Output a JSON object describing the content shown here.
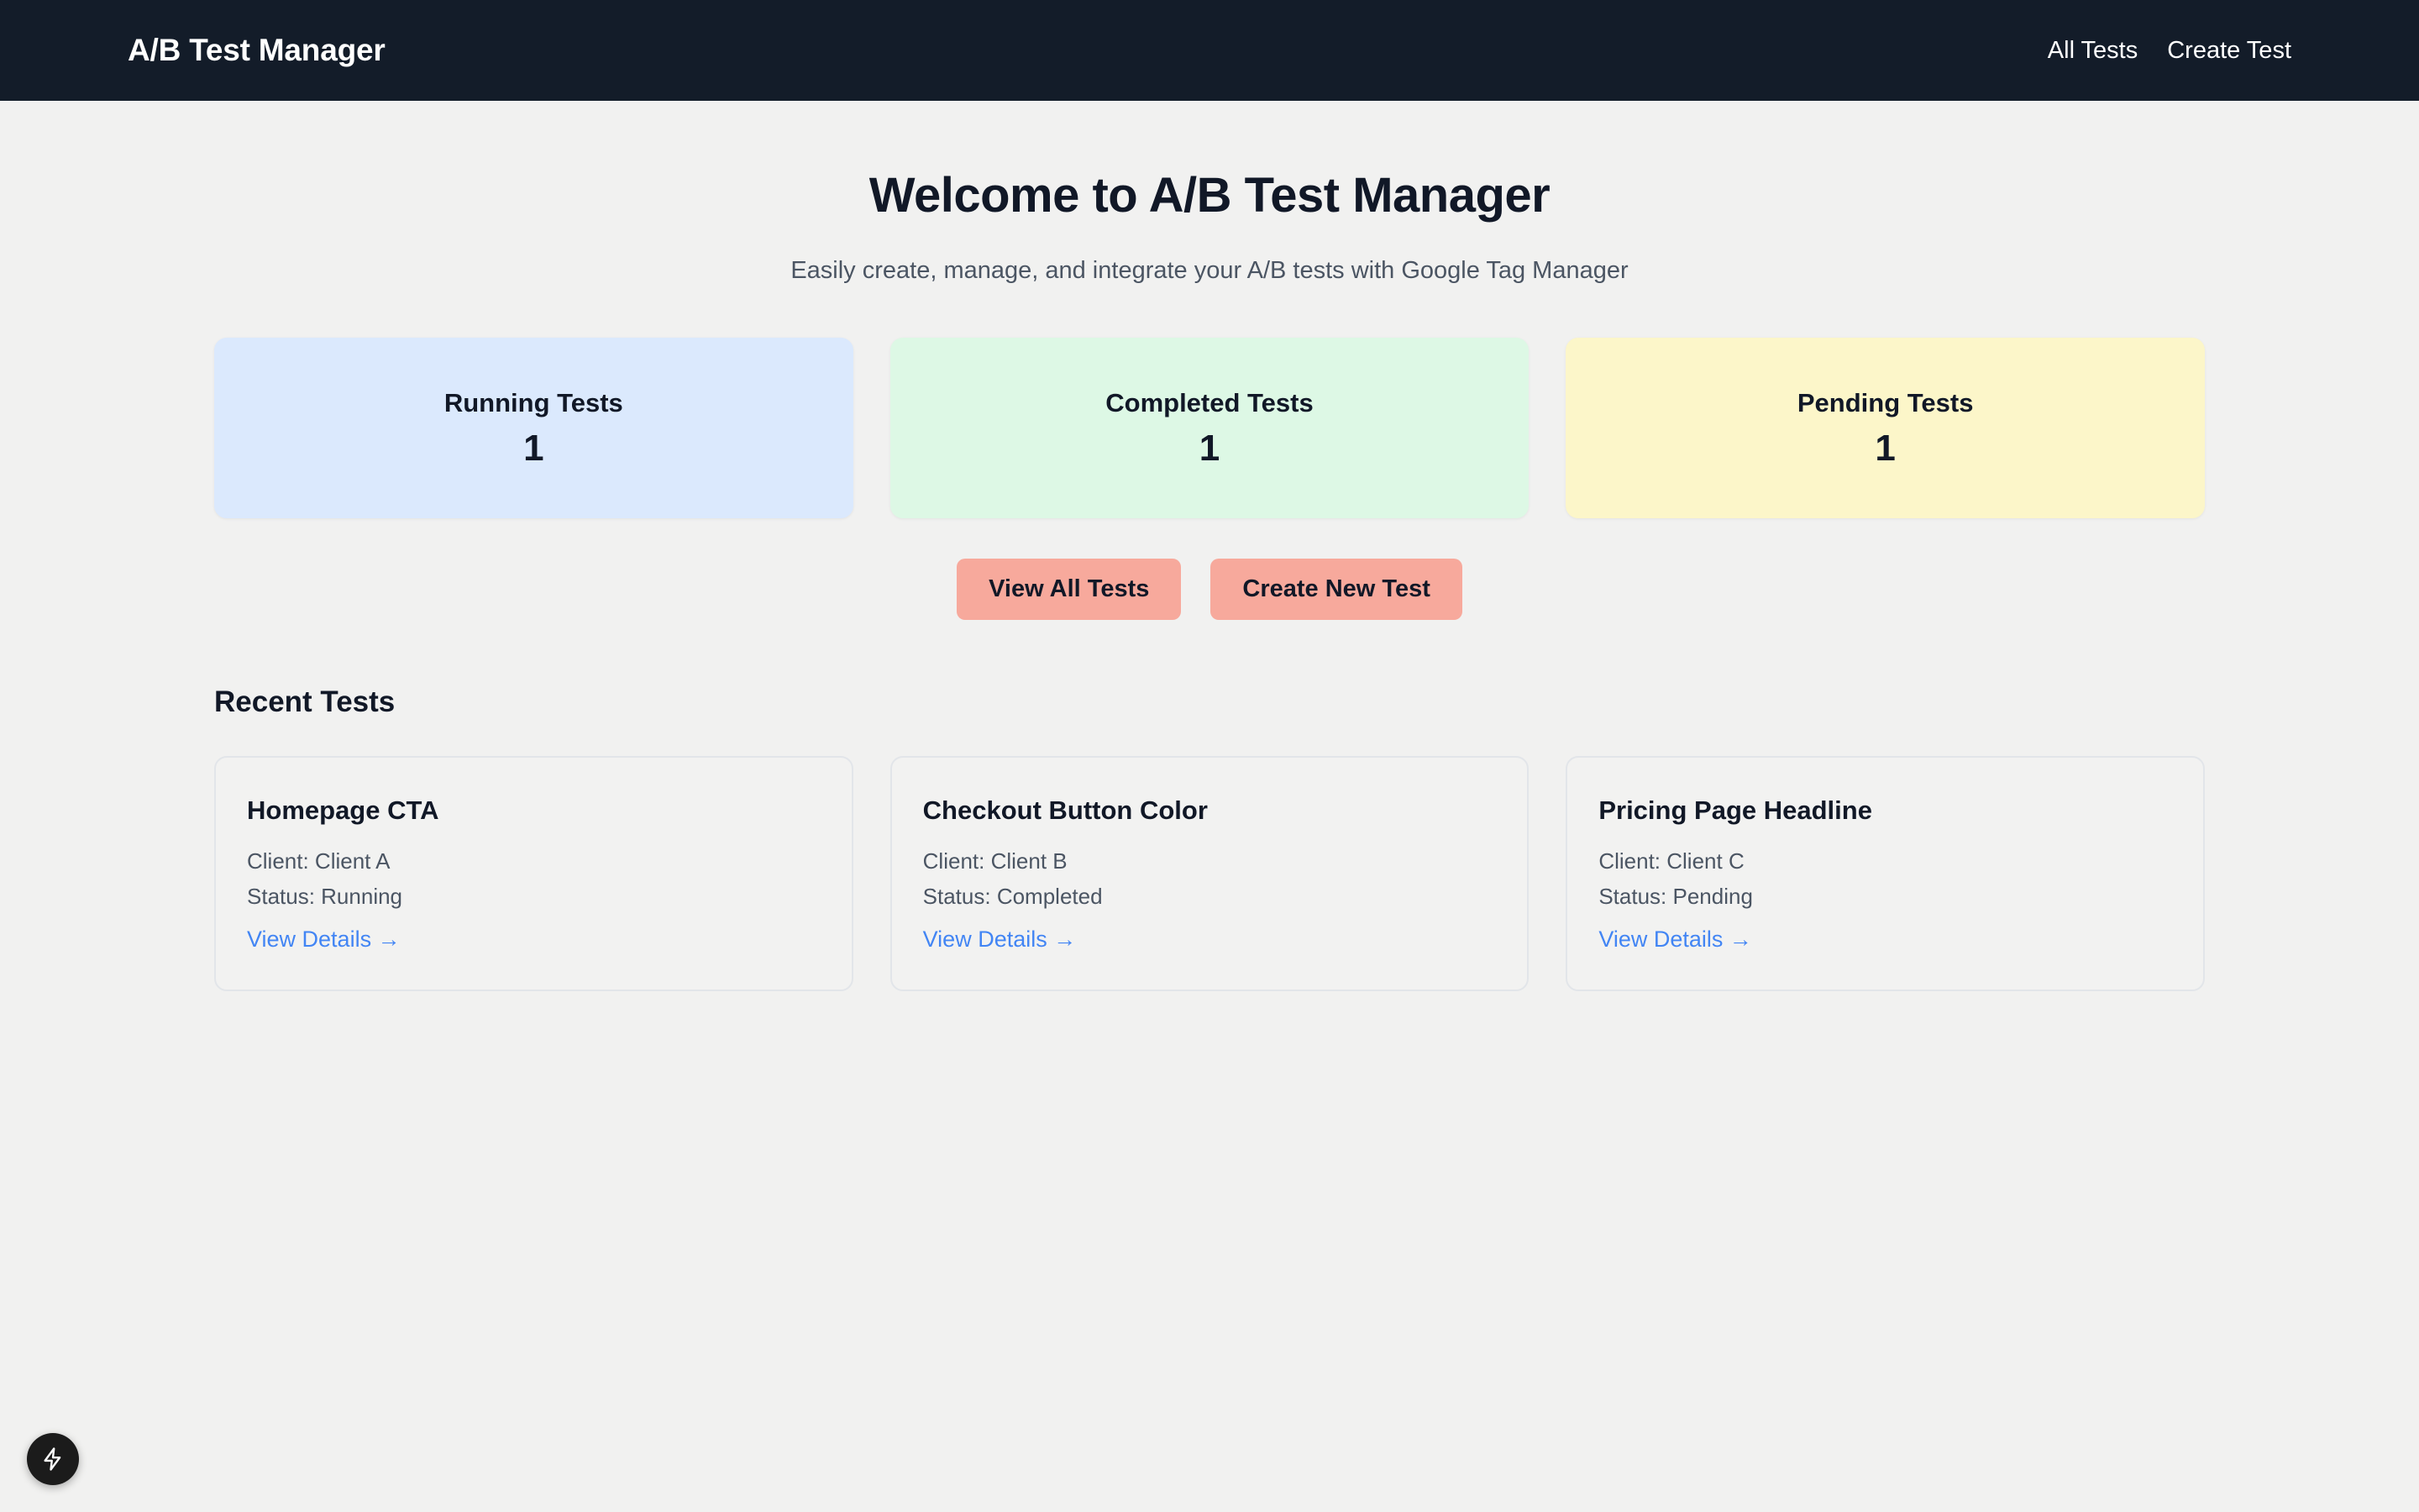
{
  "header": {
    "brand": "A/B Test Manager",
    "nav": [
      {
        "label": "All Tests"
      },
      {
        "label": "Create Test"
      }
    ]
  },
  "hero": {
    "title": "Welcome to A/B Test Manager",
    "subtitle": "Easily create, manage, and integrate your A/B tests with Google Tag Manager"
  },
  "stats": [
    {
      "label": "Running Tests",
      "value": "1",
      "color": "#dbe9fd"
    },
    {
      "label": "Completed Tests",
      "value": "1",
      "color": "#ddf8e5"
    },
    {
      "label": "Pending Tests",
      "value": "1",
      "color": "#fcf6c9"
    }
  ],
  "actions": {
    "accent_color": "#f7a99c",
    "buttons": [
      {
        "label": "View All Tests"
      },
      {
        "label": "Create New Test"
      }
    ]
  },
  "recent": {
    "section_title": "Recent Tests",
    "link_color": "#4285f4",
    "tests": [
      {
        "name": "Homepage CTA",
        "client": "Client: Client A",
        "status": "Status: Running",
        "link": "View Details →"
      },
      {
        "name": "Checkout Button Color",
        "client": "Client: Client B",
        "status": "Status: Completed",
        "link": "View Details →"
      },
      {
        "name": "Pricing Page Headline",
        "client": "Client: Client C",
        "status": "Status: Pending",
        "link": "View Details →"
      }
    ]
  },
  "fab": {
    "icon": "lightning-bolt-icon",
    "background": "#1b1b1b"
  }
}
